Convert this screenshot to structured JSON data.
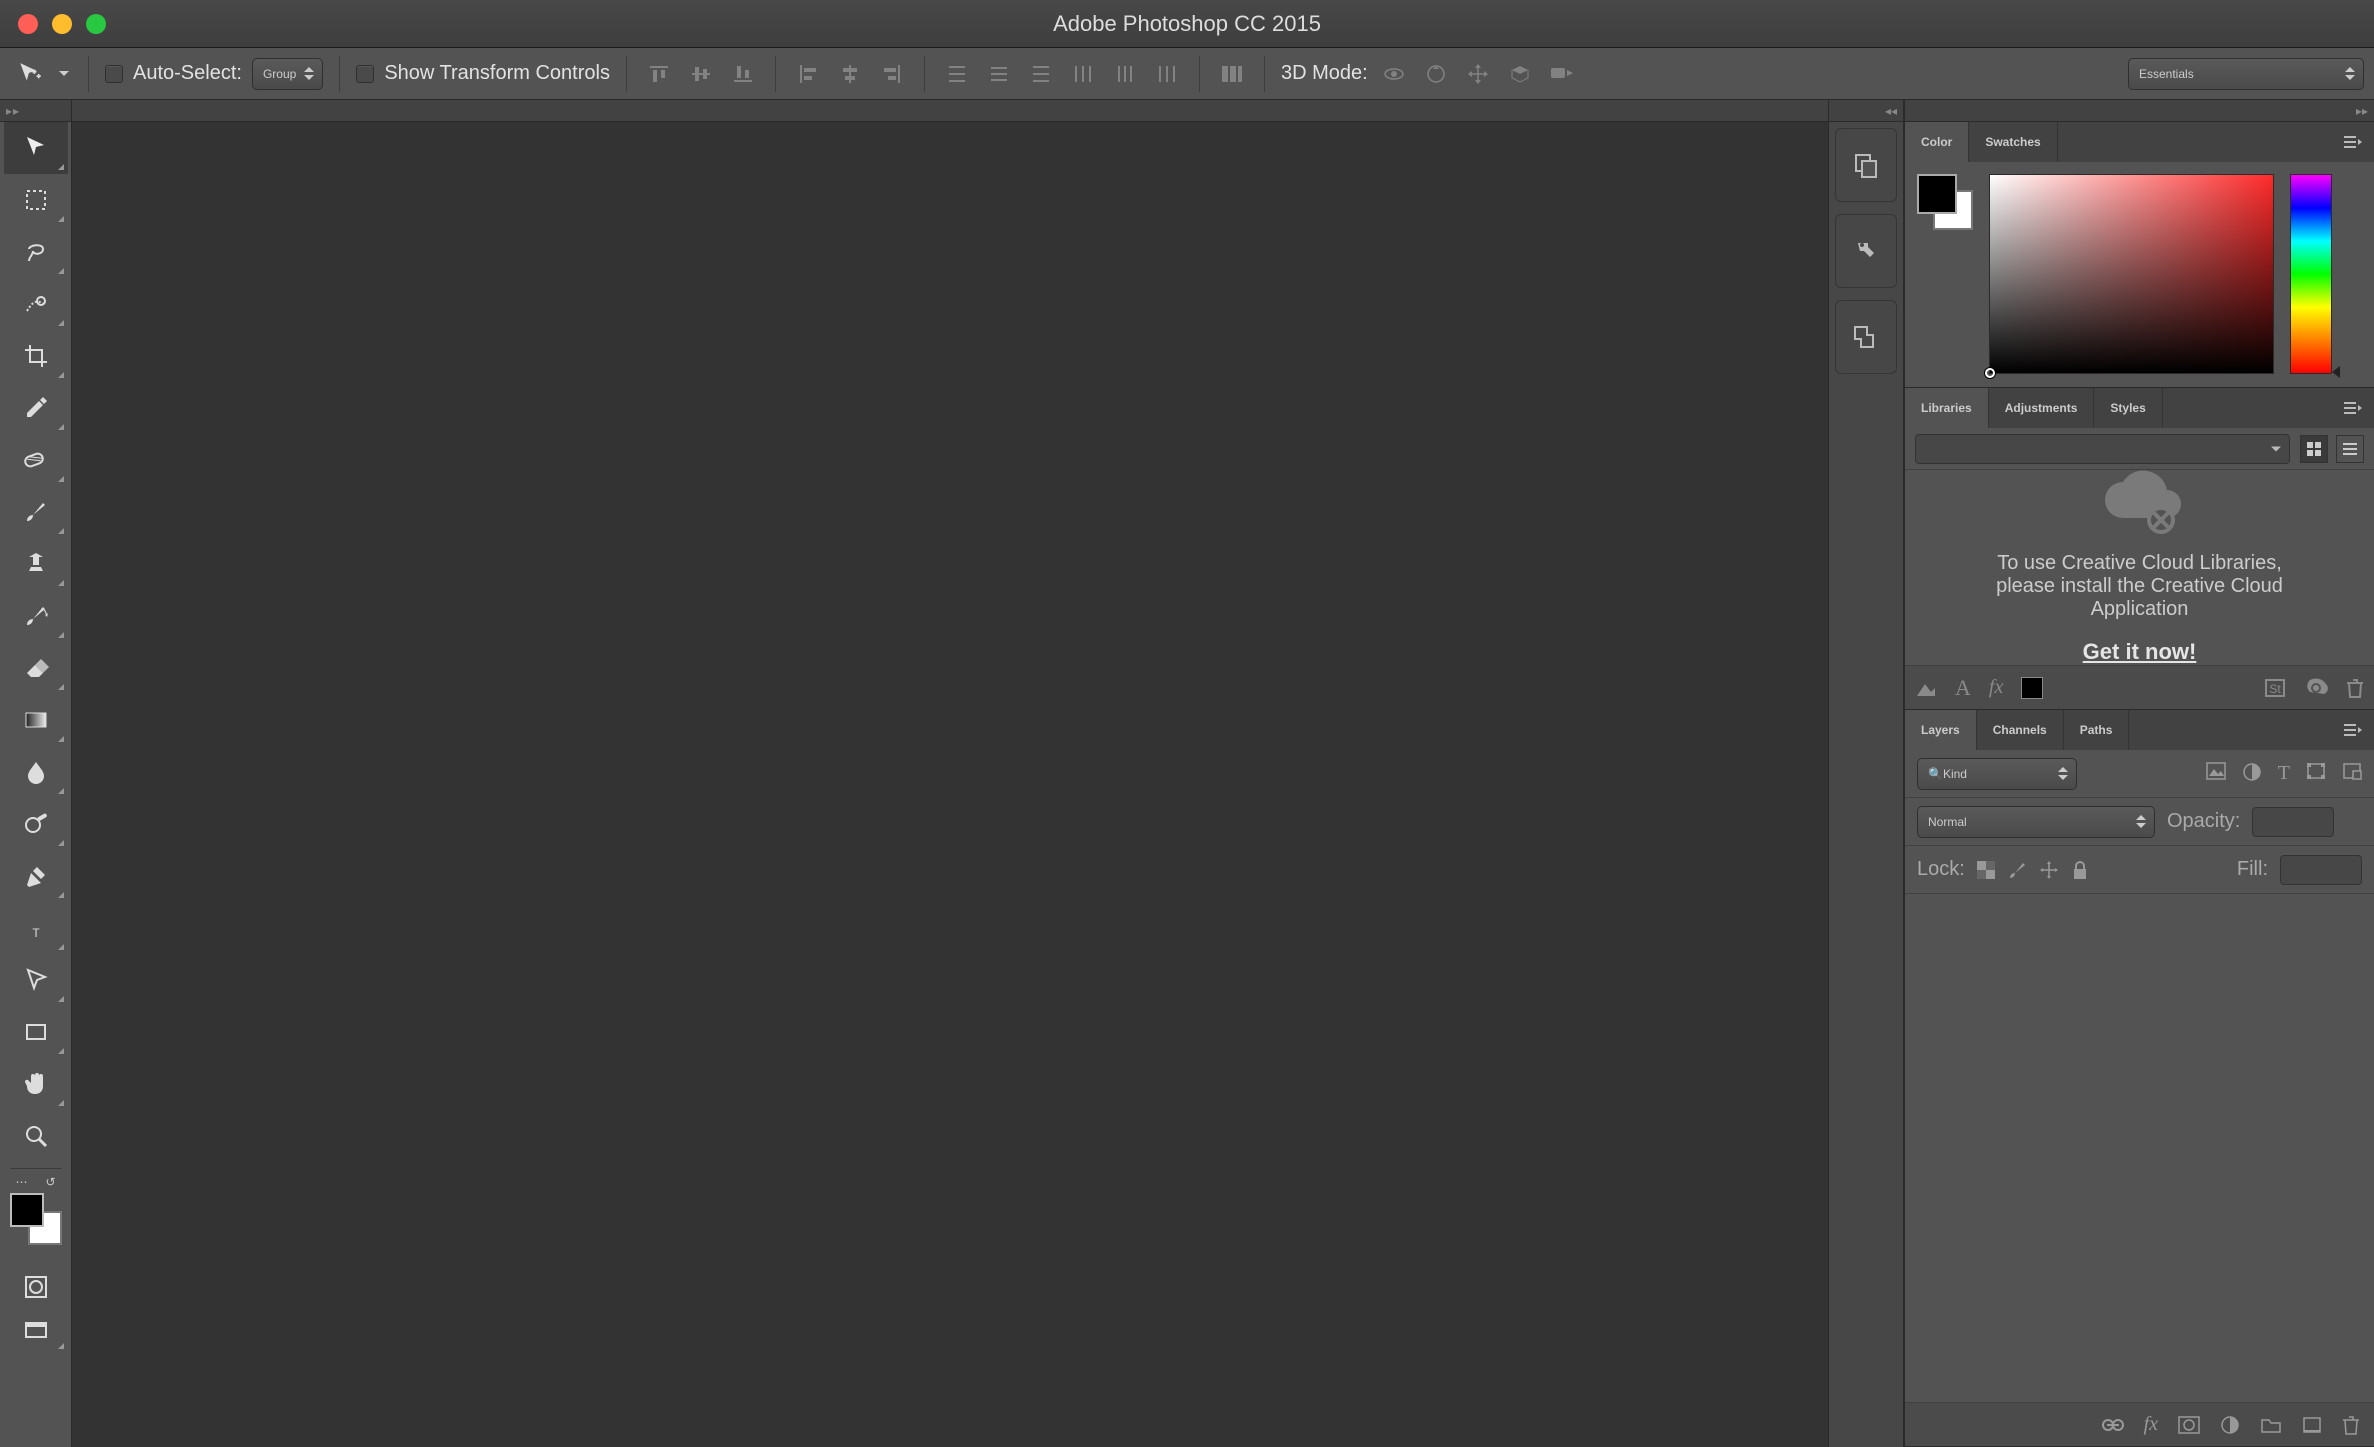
{
  "app_title": "Adobe Photoshop CC 2015",
  "options_bar": {
    "auto_select_label": "Auto-Select:",
    "auto_select_mode": "Group",
    "show_transform_label": "Show Transform Controls",
    "mode3d_label": "3D Mode:"
  },
  "workspace_selector": "Essentials",
  "tools": [
    {
      "name": "move-tool"
    },
    {
      "name": "rectangular-marquee-tool"
    },
    {
      "name": "lasso-tool"
    },
    {
      "name": "quick-selection-tool"
    },
    {
      "name": "crop-tool"
    },
    {
      "name": "eyedropper-tool"
    },
    {
      "name": "spot-healing-brush-tool"
    },
    {
      "name": "brush-tool"
    },
    {
      "name": "clone-stamp-tool"
    },
    {
      "name": "history-brush-tool"
    },
    {
      "name": "eraser-tool"
    },
    {
      "name": "gradient-tool"
    },
    {
      "name": "blur-tool"
    },
    {
      "name": "dodge-tool"
    },
    {
      "name": "pen-tool"
    },
    {
      "name": "horizontal-type-tool"
    },
    {
      "name": "path-selection-tool"
    },
    {
      "name": "rectangle-tool"
    },
    {
      "name": "hand-tool"
    },
    {
      "name": "zoom-tool"
    }
  ],
  "dock_icons": [
    {
      "name": "history-panel-icon"
    },
    {
      "name": "properties-panel-icon"
    },
    {
      "name": "info-panel-icon"
    }
  ],
  "panels": {
    "color": {
      "tabs": [
        "Color",
        "Swatches"
      ],
      "active": "Color",
      "foreground": "#000000",
      "background": "#ffffff"
    },
    "libraries": {
      "tabs": [
        "Libraries",
        "Adjustments",
        "Styles"
      ],
      "active": "Libraries",
      "message_line1": "To use Creative Cloud Libraries,",
      "message_line2": "please install the Creative Cloud",
      "message_line3": "Application",
      "cta": "Get it now!"
    },
    "layers": {
      "tabs": [
        "Layers",
        "Channels",
        "Paths"
      ],
      "active": "Layers",
      "filter_label": "Kind",
      "blend_mode": "Normal",
      "opacity_label": "Opacity:",
      "opacity_value": "",
      "lock_label": "Lock:",
      "fill_label": "Fill:",
      "fill_value": ""
    }
  }
}
